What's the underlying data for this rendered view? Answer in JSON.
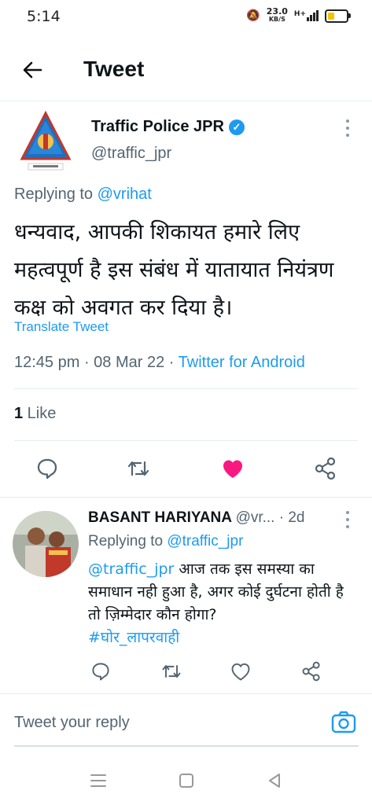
{
  "status_bar": {
    "time": "5:14",
    "net_speed_value": "23.0",
    "net_speed_unit": "KB/S",
    "signal": "H+"
  },
  "header": {
    "title": "Tweet"
  },
  "tweet": {
    "author_name": "Traffic Police JPR",
    "author_handle": "@traffic_jpr",
    "replying_prefix": "Replying to ",
    "replying_to": "@vrihat",
    "text": "धन्यवाद, आपकी शिकायत हमारे लिए महत्वपूर्ण है इस संबंध में यातायात नियंत्रण कक्ष को अवगत कर दिया है।",
    "translate_label": "Translate Tweet",
    "time": "12:45 pm",
    "date": "08 Mar 22",
    "source": "Twitter for Android",
    "like_count": "1",
    "like_label": " Like"
  },
  "reply": {
    "author_name": "BASANT HARIYANA",
    "author_handle": "@vr...",
    "age": "· 2d",
    "replying_prefix": "Replying to ",
    "replying_to": "@traffic_jpr",
    "mention": "@traffic_jpr",
    "text": " आज तक इस समस्या का समाधान नही हुआ है, अगर कोई दुर्घटना होती है तो ज़िम्मेदार कौन होगा?",
    "hashtag": "#घोर_लापरवाही"
  },
  "composer": {
    "placeholder": "Tweet your reply"
  },
  "colors": {
    "accent": "#1d9bf0",
    "like": "#f91880",
    "muted": "#536471"
  },
  "icons": [
    "back-arrow-icon",
    "verified-icon",
    "more-vertical-icon",
    "reply-icon",
    "retweet-icon",
    "heart-icon",
    "share-icon",
    "camera-icon",
    "menu-icon",
    "home-icon",
    "back-nav-icon"
  ]
}
